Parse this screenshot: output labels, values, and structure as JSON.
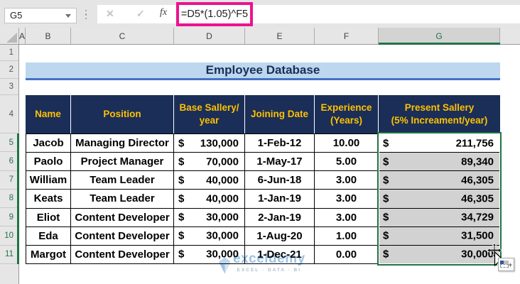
{
  "formula_bar": {
    "cell_reference": "G5",
    "formula": "=D5*(1.05)^F5",
    "cancel_icon": "✕",
    "enter_icon": "✓",
    "function_icon": "fx"
  },
  "grid": {
    "columns": [
      "A",
      "B",
      "C",
      "D",
      "E",
      "F",
      "G"
    ],
    "selected_column": "G",
    "rows": [
      "1",
      "2",
      "3",
      "4",
      "5",
      "6",
      "7",
      "8",
      "9",
      "10",
      "11"
    ],
    "selected_rows": [
      "5",
      "6",
      "7",
      "8",
      "9",
      "10",
      "11"
    ]
  },
  "table": {
    "title": "Employee Database",
    "currency": "$",
    "headers": [
      "Name",
      "Position",
      "Base Sallery/\nyear",
      "Joining Date",
      "Experience\n(Years)",
      "Present Sallery\n(5% Increament/year)"
    ],
    "rows": [
      {
        "name": "Jacob",
        "position": "Managing Director",
        "base": "130,000",
        "joining": "1-Feb-12",
        "experience": "10.00",
        "present": "211,756"
      },
      {
        "name": "Paolo",
        "position": "Project Manager",
        "base": "70,000",
        "joining": "1-May-17",
        "experience": "5.00",
        "present": "89,340"
      },
      {
        "name": "William",
        "position": "Team Leader",
        "base": "40,000",
        "joining": "6-Jun-18",
        "experience": "3.00",
        "present": "46,305"
      },
      {
        "name": "Keats",
        "position": "Team Leader",
        "base": "40,000",
        "joining": "1-Jan-19",
        "experience": "3.00",
        "present": "46,305"
      },
      {
        "name": "Eliot",
        "position": "Content Developer",
        "base": "30,000",
        "joining": "2-Jan-19",
        "experience": "3.00",
        "present": "34,729"
      },
      {
        "name": "Eda",
        "position": "Content Developer",
        "base": "30,000",
        "joining": "1-Aug-20",
        "experience": "1.00",
        "present": "31,500"
      },
      {
        "name": "Margot",
        "position": "Content Developer",
        "base": "30,000",
        "joining": "1-Dec-21",
        "experience": "0.00",
        "present": "30,000"
      }
    ]
  },
  "watermark": {
    "brand": "exceldemy",
    "tagline": "EXCEL · DATA · BI"
  },
  "colors": {
    "header_navy": "#1A2E57",
    "header_gold": "#FFC000",
    "banner_fill": "#BDD7EE",
    "banner_border": "#4472C4",
    "selection_green": "#217346",
    "selected_fill": "#D2D2D2",
    "formula_highlight": "#EC138F"
  }
}
